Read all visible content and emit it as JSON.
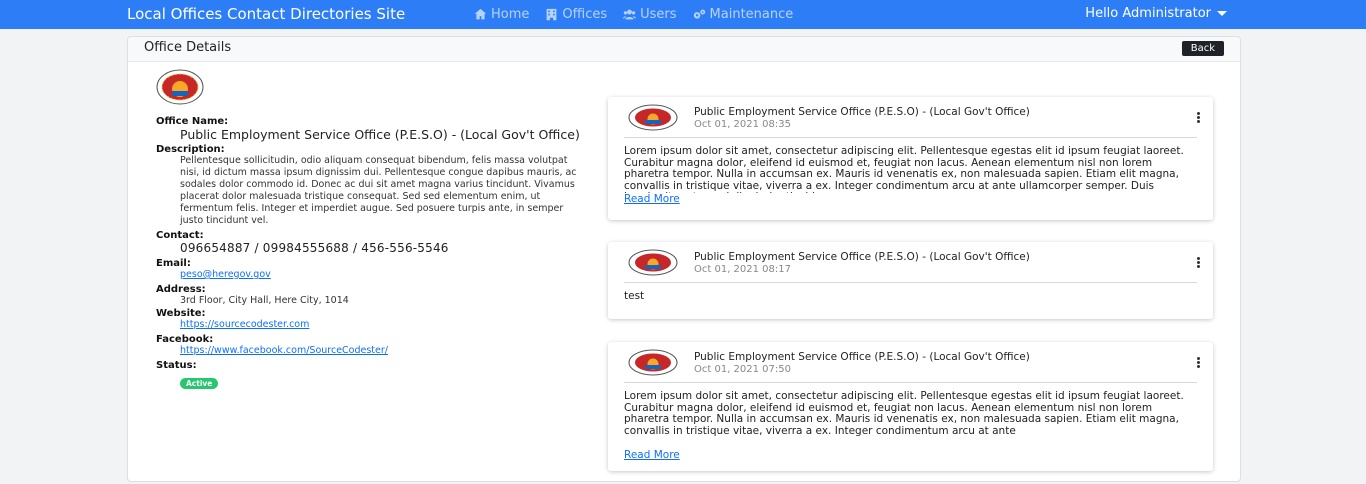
{
  "navbar": {
    "brand": "Local Offices Contact Directories Site",
    "links": [
      {
        "label": "Home",
        "icon": "home-icon"
      },
      {
        "label": "Offices",
        "icon": "building-icon"
      },
      {
        "label": "Users",
        "icon": "users-icon"
      },
      {
        "label": "Maintenance",
        "icon": "cogs-icon"
      }
    ],
    "user": "Hello Administrator"
  },
  "card": {
    "title": "Office Details",
    "back_label": "Back"
  },
  "office": {
    "name_label": "Office Name:",
    "name": "Public Employment Service Office (P.E.S.O) - (Local Gov't Office)",
    "description_label": "Description:",
    "description": "Pellentesque sollicitudin, odio aliquam consequat bibendum, felis massa volutpat nisi, id dictum massa ipsum dignissim dui. Pellentesque congue dapibus mauris, ac sodales dolor commodo id. Donec ac dui sit amet magna varius tincidunt. Vivamus placerat dolor malesuada tristique consequat. Sed sed elementum enim, ut fermentum felis. Integer et imperdiet augue. Sed posuere turpis ante, in semper justo tincidunt vel.",
    "contact_label": "Contact:",
    "contact": "096654887 / 09984555688 / 456-556-5546",
    "email_label": "Email:",
    "email": "peso@heregov.gov",
    "address_label": "Address:",
    "address": "3rd Floor, City Hall, Here City, 1014",
    "website_label": "Website:",
    "website": "https://sourcecodester.com",
    "facebook_label": "Facebook:",
    "facebook": "https://www.facebook.com/SourceCodester/",
    "status_label": "Status:",
    "status": "Active"
  },
  "posts": [
    {
      "title": "Public Employment Service Office (P.E.S.O) - (Local Gov't Office)",
      "date": "Oct 01, 2021 08:35",
      "body": "Lorem ipsum dolor sit amet, consectetur adipiscing elit. Pellentesque egestas elit id ipsum feugiat laoreet. Curabitur magna dolor, eleifend id euismod et, feugiat non lacus. Aenean elementum nisl non lorem pharetra tempor. Nulla in accumsan ex. Mauris id venenatis ex, non malesuada sapien. Etiam elit magna, convallis in tristique vitae, viverra a ex. Integer condimentum arcu at ante ullamcorper semper. Duis hendrerit erat a orci dignissim tincid...",
      "read_more": "Read More"
    },
    {
      "title": "Public Employment Service Office (P.E.S.O) - (Local Gov't Office)",
      "date": "Oct 01, 2021 08:17",
      "body": "test",
      "read_more": ""
    },
    {
      "title": "Public Employment Service Office (P.E.S.O) - (Local Gov't Office)",
      "date": "Oct 01, 2021 07:50",
      "body": "Lorem ipsum dolor sit amet, consectetur adipiscing elit. Pellentesque egestas elit id ipsum feugiat laoreet. Curabitur magna dolor, eleifend id euismod et, feugiat non lacus. Aenean elementum nisl non lorem pharetra tempor. Nulla in accumsan ex. Mauris id venenatis ex, non malesuada sapien. Etiam elit magna, convallis in tristique vitae, viverra a ex. Integer condimentum arcu at ante",
      "read_more": "Read More"
    }
  ],
  "colors": {
    "navbar": "#2d7ef6",
    "badge": "#28c76f",
    "link": "#0d6efd"
  }
}
